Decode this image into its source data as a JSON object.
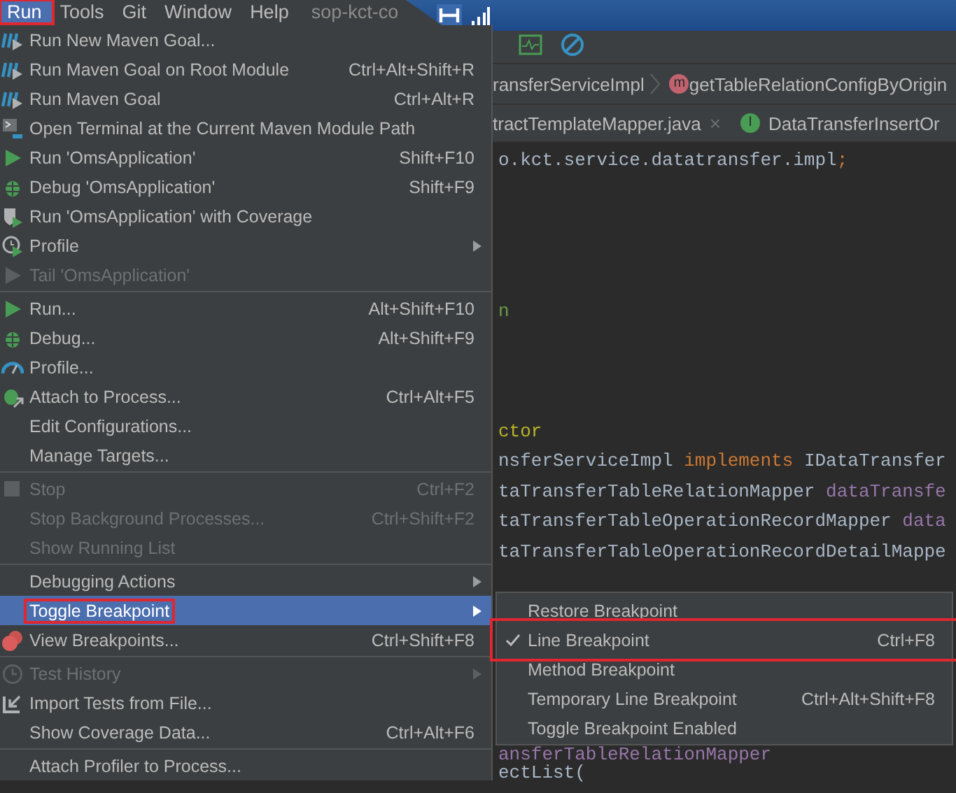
{
  "menubar": {
    "items": [
      {
        "label": "Run",
        "selected": true,
        "annotated": true
      },
      {
        "label": "Tools",
        "selected": false
      },
      {
        "label": "Git",
        "selected": false
      },
      {
        "label": "Window",
        "selected": false
      },
      {
        "label": "Help",
        "selected": false
      }
    ],
    "title": "sop-kct-co"
  },
  "breadcrumb": [
    {
      "label": "ransferServiceImpl"
    },
    {
      "label": "getTableRelationConfigByOrigin",
      "badge": "m"
    }
  ],
  "tabs": [
    {
      "label": "tractTemplateMapper.java",
      "close": "×"
    },
    {
      "label": "DataTransferInsertOr",
      "badge": "I"
    }
  ],
  "code_lines": [
    {
      "tokens": [
        {
          "text": "o.kct.service.datatransfer.impl",
          "kind": "plain"
        },
        {
          "text": ";",
          "kind": "keyword"
        }
      ]
    },
    {
      "tokens": [
        {
          "text": "n",
          "kind": "string"
        }
      ]
    },
    {
      "tokens": [
        {
          "text": "ctor",
          "kind": "annotation"
        }
      ]
    },
    {
      "tokens": [
        {
          "text": "nsferServiceImpl ",
          "kind": "plain"
        },
        {
          "text": "implements",
          "kind": "keyword"
        },
        {
          "text": " IDataTransfer",
          "kind": "plain"
        }
      ]
    },
    {
      "tokens": [
        {
          "text": "taTransferTableRelationMapper ",
          "kind": "plain"
        },
        {
          "text": "dataTransfe",
          "kind": "field"
        }
      ]
    },
    {
      "tokens": [
        {
          "text": "taTransferTableOperationRecordMapper ",
          "kind": "plain"
        },
        {
          "text": "data",
          "kind": "field"
        }
      ]
    },
    {
      "tokens": [
        {
          "text": "taTransferTableOperationRecordDetailMappe",
          "kind": "plain"
        }
      ]
    },
    {
      "tokens": [
        {
          "text": "ansferTableRelationMapper",
          "kind": "field"
        }
      ]
    },
    {
      "tokens": [
        {
          "text": "ectList(",
          "kind": "plain"
        }
      ]
    }
  ],
  "menu": {
    "groups": [
      {
        "items": [
          {
            "label": "Run New Maven Goal...",
            "disabled": false,
            "selected": false
          },
          {
            "label": "Run Maven Goal on Root Module",
            "shortcut": "Ctrl+Alt+Shift+R",
            "disabled": false,
            "selected": false
          },
          {
            "label": "Run Maven Goal",
            "shortcut": "Ctrl+Alt+R",
            "disabled": false,
            "selected": false
          },
          {
            "label": "Open Terminal at the Current Maven Module Path",
            "disabled": false,
            "selected": false
          },
          {
            "label": "Run 'OmsApplication'",
            "shortcut": "Shift+F10",
            "disabled": false,
            "selected": false
          },
          {
            "label": "Debug 'OmsApplication'",
            "shortcut": "Shift+F9",
            "disabled": false,
            "selected": false
          },
          {
            "label": "Run 'OmsApplication' with Coverage",
            "disabled": false,
            "selected": false
          },
          {
            "label": "Profile",
            "has_submenu": true,
            "disabled": false,
            "selected": false
          },
          {
            "label": "Tail 'OmsApplication'",
            "disabled": true,
            "selected": false
          }
        ]
      },
      {
        "items": [
          {
            "label": "Run...",
            "shortcut": "Alt+Shift+F10",
            "disabled": false,
            "selected": false
          },
          {
            "label": "Debug...",
            "shortcut": "Alt+Shift+F9",
            "disabled": false,
            "selected": false
          },
          {
            "label": "Profile...",
            "disabled": false,
            "selected": false
          },
          {
            "label": "Attach to Process...",
            "shortcut": "Ctrl+Alt+F5",
            "disabled": false,
            "selected": false
          },
          {
            "label": "Edit Configurations...",
            "disabled": false,
            "selected": false
          },
          {
            "label": "Manage Targets...",
            "disabled": false,
            "selected": false
          }
        ]
      },
      {
        "items": [
          {
            "label": "Stop",
            "shortcut": "Ctrl+F2",
            "disabled": true,
            "selected": false
          },
          {
            "label": "Stop Background Processes...",
            "shortcut": "Ctrl+Shift+F2",
            "disabled": true,
            "selected": false
          },
          {
            "label": "Show Running List",
            "disabled": true,
            "selected": false
          }
        ]
      },
      {
        "items": [
          {
            "label": "Debugging Actions",
            "has_submenu": true,
            "disabled": false,
            "selected": false
          },
          {
            "label": "Toggle Breakpoint",
            "has_submenu": true,
            "disabled": false,
            "selected": true,
            "annotated": true
          },
          {
            "label": "View Breakpoints...",
            "shortcut": "Ctrl+Shift+F8",
            "disabled": false,
            "selected": false
          }
        ]
      },
      {
        "items": [
          {
            "label": "Test History",
            "has_submenu": true,
            "disabled": true,
            "selected": false
          },
          {
            "label": "Import Tests from File...",
            "disabled": false,
            "selected": false
          },
          {
            "label": "Show Coverage Data...",
            "shortcut": "Ctrl+Alt+F6",
            "disabled": false,
            "selected": false
          }
        ]
      },
      {
        "items": [
          {
            "label": "Attach Profiler to Process...",
            "disabled": false,
            "selected": false
          }
        ]
      }
    ]
  },
  "submenu": {
    "items": [
      {
        "label": "Restore Breakpoint",
        "checked": false
      },
      {
        "label": "Line Breakpoint",
        "shortcut": "Ctrl+F8",
        "checked": true,
        "annotated": true
      },
      {
        "label": "Method Breakpoint",
        "checked": false
      },
      {
        "label": "Temporary Line Breakpoint",
        "shortcut": "Ctrl+Alt+Shift+F8",
        "checked": false
      },
      {
        "label": "Toggle Breakpoint Enabled",
        "checked": false
      }
    ]
  }
}
